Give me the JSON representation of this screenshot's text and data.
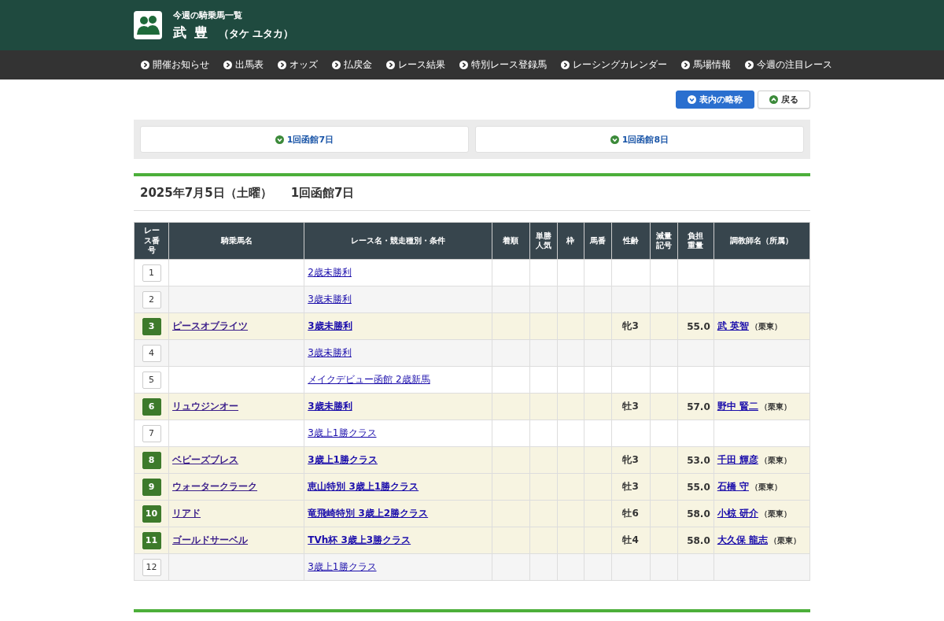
{
  "header": {
    "subtitle": "今週の騎乗馬一覧",
    "name": "武 豊",
    "reading": "（タケ ユタカ）"
  },
  "nav": [
    {
      "label": "開催お知らせ"
    },
    {
      "label": "出馬表"
    },
    {
      "label": "オッズ"
    },
    {
      "label": "払戻金"
    },
    {
      "label": "レース結果"
    },
    {
      "label": "特別レース登録馬"
    },
    {
      "label": "レーシングカレンダー"
    },
    {
      "label": "馬場情報"
    },
    {
      "label": "今週の注目レース"
    }
  ],
  "buttons": [
    {
      "label": "表内の略称",
      "kind": "primary"
    },
    {
      "label": "戻る",
      "kind": "back"
    }
  ],
  "meet_tabs": [
    {
      "label": "1回函館7日"
    },
    {
      "label": "1回函館8日"
    }
  ],
  "day": {
    "date": "2025年7月5日（土曜）",
    "meeting": "1回函館7日"
  },
  "table": {
    "columns": [
      "レース番号",
      "騎乗馬名",
      "レース名・競走種別・条件",
      "着順",
      "単勝人気",
      "枠",
      "馬番",
      "性齢",
      "減量記号",
      "負担重量",
      "調教師名（所属）"
    ],
    "rows": [
      {
        "race_no": "1",
        "riding": false,
        "race": "2歳未勝利"
      },
      {
        "race_no": "2",
        "riding": false,
        "race": "3歳未勝利"
      },
      {
        "race_no": "3",
        "riding": true,
        "horse": "ピースオブライツ",
        "race": "3歳未勝利",
        "sex_age": "牝3",
        "weight": "55.0",
        "trainer": "武 英智",
        "affiliation": "（栗東）"
      },
      {
        "race_no": "4",
        "riding": false,
        "race": "3歳未勝利"
      },
      {
        "race_no": "5",
        "riding": false,
        "race": "メイクデビュー函館 2歳新馬"
      },
      {
        "race_no": "6",
        "riding": true,
        "horse": "リュウジンオー",
        "race": "3歳未勝利",
        "sex_age": "牡3",
        "weight": "57.0",
        "trainer": "野中 賢二",
        "affiliation": "（栗東）"
      },
      {
        "race_no": "7",
        "riding": false,
        "race": "3歳上1勝クラス"
      },
      {
        "race_no": "8",
        "riding": true,
        "horse": "ベビーズブレス",
        "race": "3歳上1勝クラス",
        "sex_age": "牝3",
        "weight": "53.0",
        "trainer": "千田 輝彦",
        "affiliation": "（栗東）"
      },
      {
        "race_no": "9",
        "riding": true,
        "horse": "ウォータークラーク",
        "race": "恵山特別 3歳上1勝クラス",
        "sex_age": "牡3",
        "weight": "55.0",
        "trainer": "石橋 守",
        "affiliation": "（栗東）"
      },
      {
        "race_no": "10",
        "riding": true,
        "horse": "リアド",
        "race": "竜飛崎特別 3歳上2勝クラス",
        "sex_age": "牡6",
        "weight": "58.0",
        "trainer": "小椋 研介",
        "affiliation": "（栗東）"
      },
      {
        "race_no": "11",
        "riding": true,
        "horse": "ゴールドサーベル",
        "race": "TVh杯 3歳上3勝クラス",
        "sex_age": "牡4",
        "weight": "58.0",
        "trainer": "大久保 龍志",
        "affiliation": "（栗東）"
      },
      {
        "race_no": "12",
        "riding": false,
        "race": "3歳上1勝クラス"
      }
    ]
  }
}
